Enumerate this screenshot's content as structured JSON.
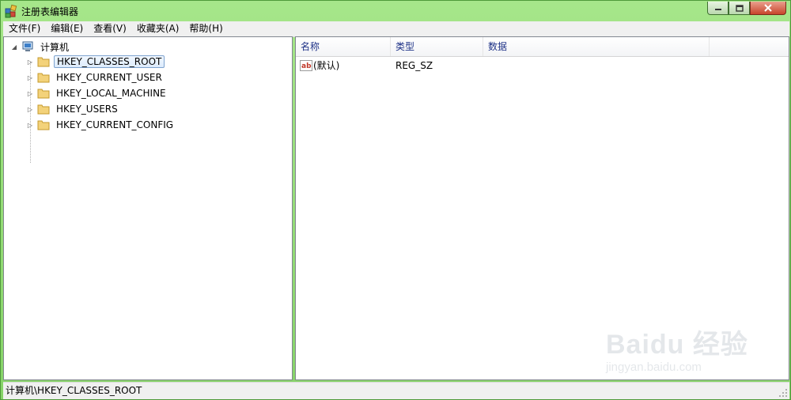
{
  "window": {
    "title": "注册表编辑器"
  },
  "menu": [
    "文件(F)",
    "编辑(E)",
    "查看(V)",
    "收藏夹(A)",
    "帮助(H)"
  ],
  "tree": {
    "root": "计算机",
    "items": [
      {
        "label": "HKEY_CLASSES_ROOT",
        "selected": true
      },
      {
        "label": "HKEY_CURRENT_USER"
      },
      {
        "label": "HKEY_LOCAL_MACHINE"
      },
      {
        "label": "HKEY_USERS"
      },
      {
        "label": "HKEY_CURRENT_CONFIG"
      }
    ]
  },
  "list": {
    "columns": [
      "名称",
      "类型",
      "数据"
    ],
    "rows": [
      {
        "name": "(默认)",
        "type": "REG_SZ",
        "data": "",
        "icon": "ab-string-icon"
      }
    ]
  },
  "status": {
    "path": "计算机\\HKEY_CLASSES_ROOT"
  },
  "watermark": {
    "brand": "Baidu 经验",
    "url": "jingyan.baidu.com"
  },
  "colors": {
    "titlebar": "#a6e68a",
    "header_text": "#1e3287",
    "selection": "#dcebfc"
  }
}
